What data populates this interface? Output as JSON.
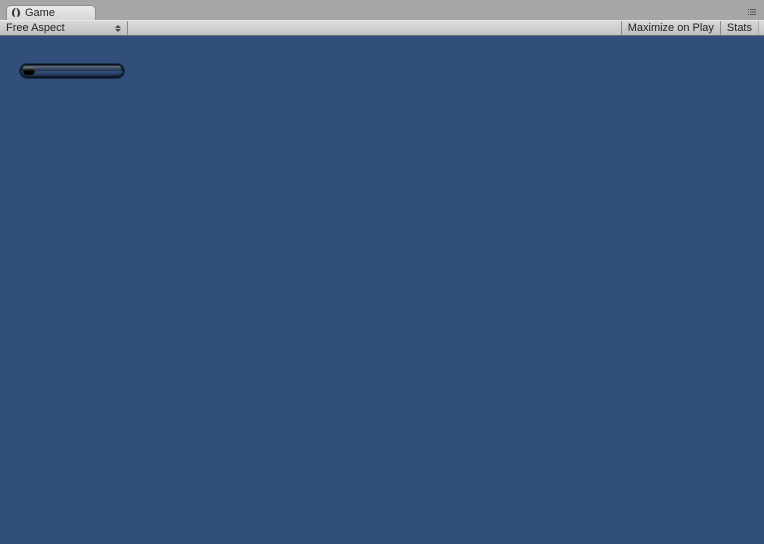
{
  "tab": {
    "title": "Game"
  },
  "toolbar": {
    "aspect_label": "Free Aspect",
    "maximize_label": "Maximize on Play",
    "stats_label": "Stats"
  },
  "viewport": {
    "background_color": "#324f7b",
    "progress": {
      "value": 12,
      "max": 100,
      "fill_color": "#0a0a0a",
      "track_color": "#1c2f4d"
    }
  }
}
